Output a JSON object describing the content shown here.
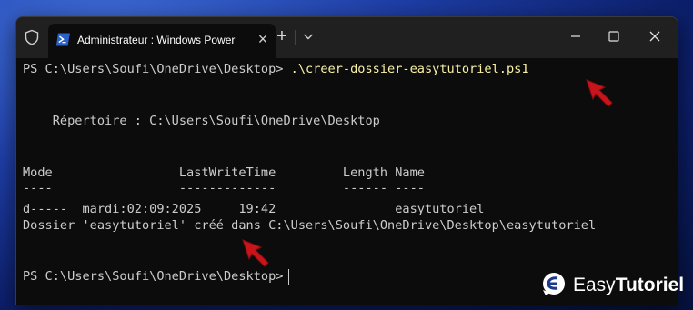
{
  "window": {
    "tab_title": "Administrateur : Windows PowerShell",
    "colors": {
      "titlebar": "#202020",
      "terminal_bg": "#0c0c0c",
      "text": "#cccccc",
      "command": "#f9f1a5",
      "arrow": "#c8141b"
    }
  },
  "terminal": {
    "prompt1": "PS C:\\Users\\Soufi\\OneDrive\\Desktop> ",
    "command1": ".\\creer-dossier-easytutoriel.ps1",
    "directory_line": "    Répertoire : C:\\Users\\Soufi\\OneDrive\\Desktop",
    "header_line": "Mode                 LastWriteTime         Length Name",
    "dash_line": "----                 -------------         ------ ----",
    "row_line": "d-----  mardi:02:09:2025     19:42                easytutoriel",
    "message_line": "Dossier 'easytutoriel' créé dans C:\\Users\\Soufi\\OneDrive\\Desktop\\easytutoriel",
    "prompt2": "PS C:\\Users\\Soufi\\OneDrive\\Desktop>"
  },
  "brand": {
    "easy": "Easy",
    "tutoriel": "Tutoriel"
  }
}
